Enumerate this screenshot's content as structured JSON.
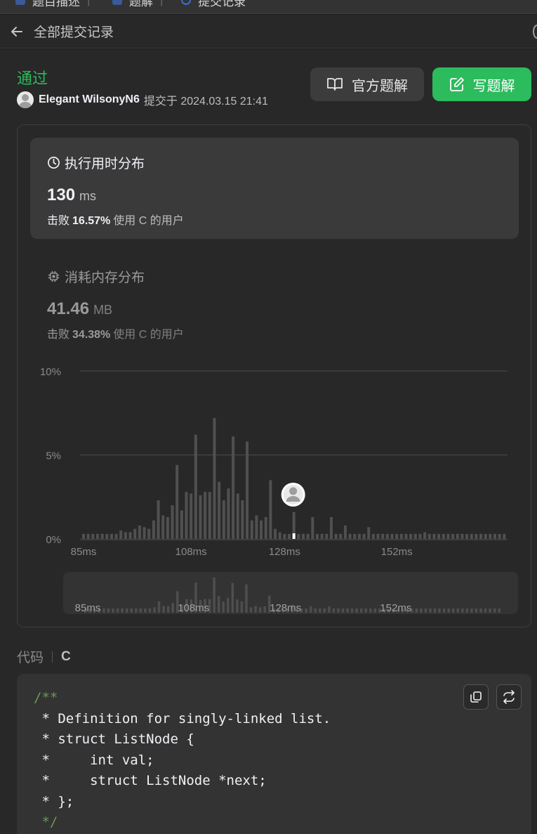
{
  "top_tabs": [
    {
      "label": "题目描述",
      "color": "#3a6fd8"
    },
    {
      "label": "题解",
      "color": "#3a6fd8"
    },
    {
      "label": "提交记录",
      "color": "#3a6fd8"
    }
  ],
  "header": {
    "back_icon": "arrow-left-icon",
    "title": "全部提交记录"
  },
  "submission": {
    "status": "通过",
    "status_color": "#2cbb5d",
    "user": "Elegant WilsonyN6",
    "submitted_text": "提交于 2024.03.15 21:41"
  },
  "buttons": {
    "official_solution": "官方题解",
    "write_solution": "写题解"
  },
  "runtime": {
    "title": "执行用时分布",
    "value": "130",
    "unit": "ms",
    "beats_prefix": "击败",
    "beats_pct": "16.57%",
    "beats_suffix": "使用 C 的用户"
  },
  "memory": {
    "title": "消耗内存分布",
    "value": "41.46",
    "unit": "MB",
    "beats_prefix": "击败",
    "beats_pct": "34.38%",
    "beats_suffix": "使用 C 的用户"
  },
  "chart_data": {
    "type": "bar",
    "y_ticks": [
      "10%",
      "5%",
      "0%"
    ],
    "ylim": [
      0,
      10
    ],
    "x_ticks": [
      {
        "label": "85ms",
        "index": 0
      },
      {
        "label": "108ms",
        "index": 23
      },
      {
        "label": "128ms",
        "index": 43
      },
      {
        "label": "152ms",
        "index": 67
      }
    ],
    "values": [
      0.3,
      0.3,
      0.3,
      0.3,
      0.3,
      0.3,
      0.3,
      0.3,
      0.5,
      0.4,
      0.4,
      0.6,
      0.8,
      0.7,
      0.6,
      1.1,
      2.3,
      1.4,
      1.3,
      2.0,
      4.4,
      1.7,
      2.8,
      2.7,
      6.2,
      2.6,
      2.8,
      2.8,
      7.2,
      3.4,
      2.3,
      3.0,
      6.1,
      2.7,
      2.3,
      5.8,
      1.1,
      1.4,
      1.1,
      1.3,
      3.5,
      0.6,
      0.4,
      0.3,
      0.3,
      1.6,
      0.3,
      0.3,
      0.3,
      1.3,
      0.3,
      0.3,
      0.3,
      1.3,
      0.3,
      0.3,
      0.8,
      0.3,
      0.3,
      0.3,
      0.3,
      0.7,
      0.3,
      0.3,
      0.3,
      0.3,
      0.3,
      0.3,
      0.3,
      0.3,
      0.3,
      0.3,
      0.3,
      0.4,
      0.3,
      0.3,
      0.3,
      0.3,
      0.3,
      0.3,
      0.3,
      0.3,
      0.3,
      0.3,
      0.3,
      0.3,
      0.3,
      0.3,
      0.3,
      0.3,
      0.3
    ],
    "current_marker_label": "",
    "bar_color": "#505050",
    "grid": true
  },
  "mini_chart": {
    "x_ticks": [
      "85ms",
      "108ms",
      "128ms",
      "152ms"
    ]
  },
  "code": {
    "label": "代码",
    "language": "C",
    "lines": [
      {
        "text": "/**",
        "comment": true
      },
      {
        "text": " * Definition for singly-linked list.",
        "comment": false
      },
      {
        "text": " * struct ListNode {",
        "comment": false
      },
      {
        "text": " *     int val;",
        "comment": false
      },
      {
        "text": " *     struct ListNode *next;",
        "comment": false
      },
      {
        "text": " * };",
        "comment": false
      },
      {
        "text": " */",
        "comment": true
      }
    ]
  }
}
